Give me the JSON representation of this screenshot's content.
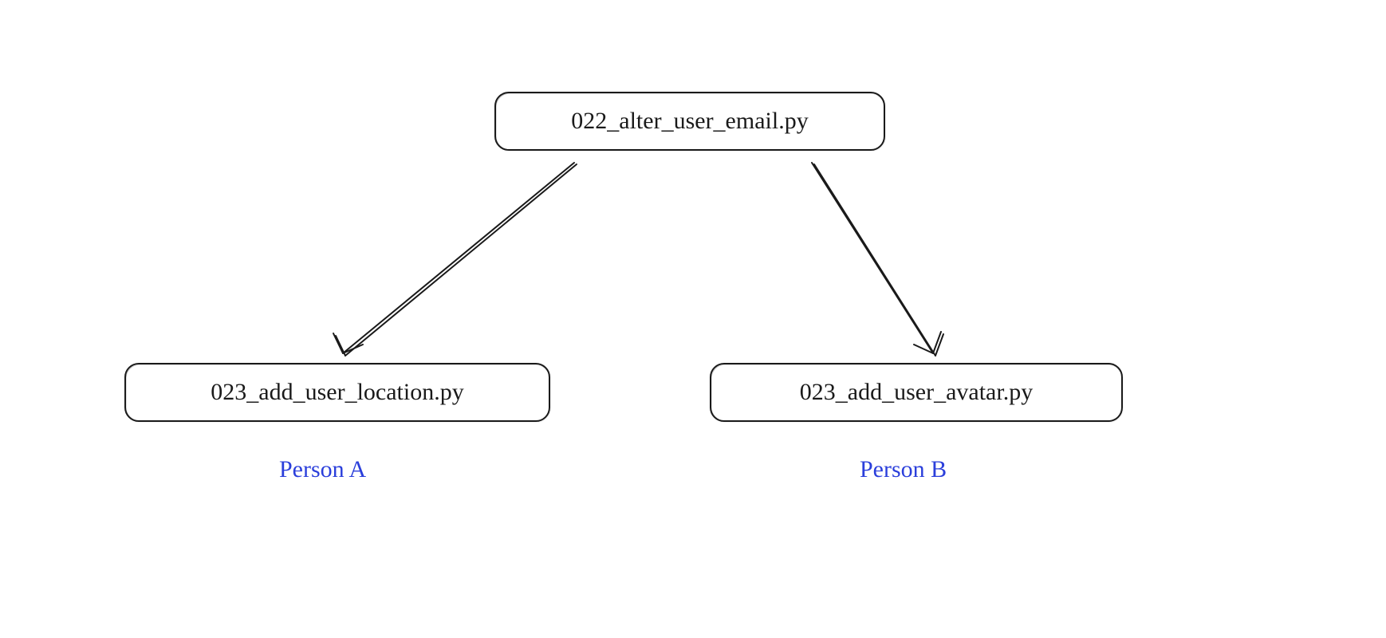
{
  "nodes": {
    "parent": {
      "label": "022_alter_user_email.py"
    },
    "left": {
      "label": "023_add_user_location.py",
      "caption": "Person A"
    },
    "right": {
      "label": "023_add_user_avatar.py",
      "caption": "Person B"
    }
  },
  "colors": {
    "node_border": "#1a1a1a",
    "caption": "#2b3fdb",
    "background": "#ffffff"
  }
}
